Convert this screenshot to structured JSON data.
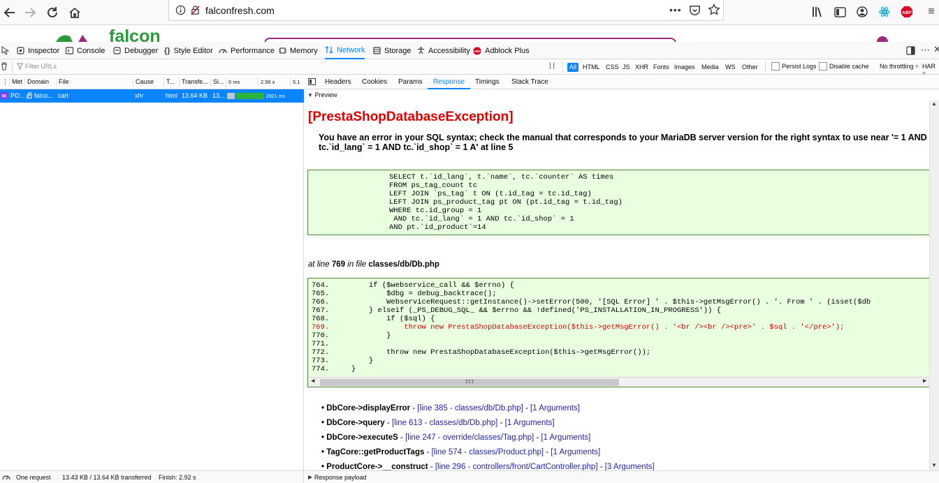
{
  "browser": {
    "url": "falconfresh.com",
    "more_label": "•••"
  },
  "page": {
    "logo_text": "falcon"
  },
  "devtools": {
    "tabs": [
      {
        "label": "Inspector",
        "icon": "inspector-icon"
      },
      {
        "label": "Console",
        "icon": "console-icon"
      },
      {
        "label": "Debugger",
        "icon": "debugger-icon"
      },
      {
        "label": "Style Editor",
        "icon": "style-editor-icon"
      },
      {
        "label": "Performance",
        "icon": "performance-icon"
      },
      {
        "label": "Memory",
        "icon": "memory-icon"
      },
      {
        "label": "Network",
        "icon": "network-icon",
        "selected": true
      },
      {
        "label": "Storage",
        "icon": "storage-icon"
      },
      {
        "label": "Accessibility",
        "icon": "accessibility-icon"
      },
      {
        "label": "Adblock Plus",
        "icon": "abp-icon"
      }
    ],
    "filter_placeholder": "Filter URLs",
    "pause_label": "| |",
    "type_filters": [
      "All",
      "HTML",
      "CSS",
      "JS",
      "XHR",
      "Fonts",
      "Images",
      "Media",
      "WS",
      "Other"
    ],
    "persist_logs": "Persist Logs",
    "disable_cache": "Disable cache",
    "throttling": "No throttling ÷",
    "har": "HAR ÷"
  },
  "request_table": {
    "headers": [
      "Met",
      "Domain",
      "File",
      "Cause",
      "T...",
      "Transfe...",
      "Si...",
      "0 ms",
      "2.56 s",
      "5.1"
    ],
    "row": {
      "method": "PO...",
      "domain": "falco...",
      "file": "cart",
      "cause": "xhr",
      "type": "html",
      "transferred": "13.64 KB",
      "size": "13...",
      "timing": "2921 ms"
    }
  },
  "details": {
    "tabs": [
      "Headers",
      "Cookies",
      "Params",
      "Response",
      "Timings",
      "Stack Trace"
    ],
    "selected_tab": "Response",
    "preview_label": "Preview",
    "response_payload": "Response payload"
  },
  "error": {
    "title": "[PrestaShopDatabaseException]",
    "message": "You have an error in your SQL syntax; check the manual that corresponds to your MariaDB server version for the right syntax to use near '= 1 AND tc.`id_lang` = 1 AND tc.`id_shop` = 1 A' at line 5",
    "sql": [
      "SELECT t.`id_lang`, t.`name`, tc.`counter` AS times",
      "FROM ps_tag_count tc",
      "LEFT JOIN `ps_tag` t ON (t.id_tag = tc.id_tag)",
      "LEFT JOIN ps_product_tag pt ON (pt.id_tag = t.id_tag)",
      "WHERE tc.id_group = 1",
      " AND tc.`id_lang` = 1 AND tc.`id_shop` = 1",
      "AND pt.`id_product`=14"
    ],
    "at_line_prefix": "at line",
    "line_no": "769",
    "in_file": "in file",
    "file": "classes/db/Db.php",
    "code": [
      {
        "text": "764.         if ($webservice_call && $errno) {",
        "hl": false
      },
      {
        "text": "765.             $dbg = debug_backtrace();",
        "hl": false
      },
      {
        "text": "766.             WebserviceRequest::getInstance()->setError(500, '[SQL Error] ' . $this->getMsgError() . '. From ' . (isset($db",
        "hl": false
      },
      {
        "text": "767.         } elseif (_PS_DEBUG_SQL_ && $errno && !defined('PS_INSTALLATION_IN_PROGRESS')) {",
        "hl": false
      },
      {
        "text": "768.             if ($sql) {",
        "hl": false
      },
      {
        "text": "769.                 throw new PrestaShopDatabaseException($this->getMsgError() . '<br /><br /><pre>' . $sql . '</pre>');",
        "hl": true
      },
      {
        "text": "770.             }",
        "hl": false
      },
      {
        "text": "771.",
        "hl": false
      },
      {
        "text": "772.             throw new PrestaShopDatabaseException($this->getMsgError());",
        "hl": false
      },
      {
        "text": "773.         }",
        "hl": false
      },
      {
        "text": "774.     }",
        "hl": false
      }
    ],
    "hscroll_grip": "III",
    "trace": [
      {
        "fn": "DbCore->displayError",
        "sep": " - ",
        "link": "[line 385 - classes/db/Db.php]",
        "dash": " - ",
        "args": "[1 Arguments]"
      },
      {
        "fn": "DbCore->query",
        "sep": " - ",
        "link": "[line 613 - classes/db/Db.php]",
        "dash": " - ",
        "args": "[1 Arguments]"
      },
      {
        "fn": "DbCore->executeS",
        "sep": " - ",
        "link": "[line 247 - override/classes/Tag.php]",
        "dash": " - ",
        "args": "[1 Arguments]"
      },
      {
        "fn": "TagCore::getProductTags",
        "sep": " - ",
        "link": "[line 574 - classes/Product.php]",
        "dash": " - ",
        "args": "[1 Arguments]"
      },
      {
        "fn": "ProductCore->__construct",
        "sep": " - ",
        "link": "[line 296 - controllers/front/CartController.php]",
        "dash": " - ",
        "args": "[3 Arguments]"
      }
    ]
  },
  "status": {
    "requests": "One request",
    "transferred": "13.43 KB / 13.64 KB transferred",
    "finish": "Finish: 2.92 s"
  },
  "colors": {
    "accent": "#0a84ff",
    "error_red": "#e00000",
    "code_bg": "#e8ffe0",
    "timing_green": "#2ab43b"
  }
}
